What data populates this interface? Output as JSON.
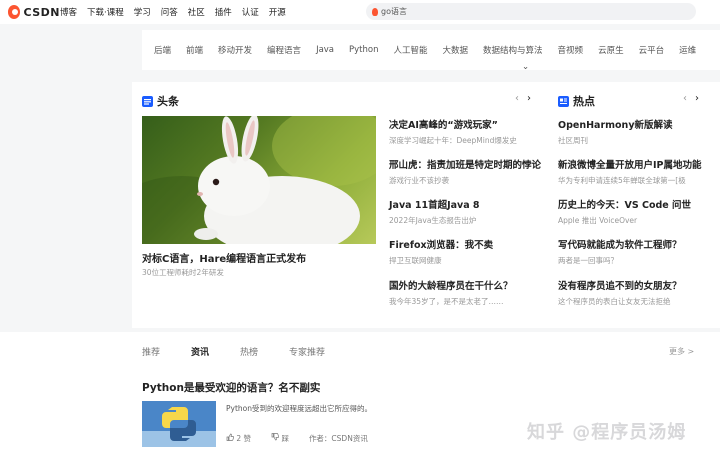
{
  "topbar": {
    "logo_text": "CSDN",
    "nav": [
      "博客",
      "下载·课程",
      "学习",
      "问答",
      "社区",
      "插件",
      "认证",
      "开源"
    ],
    "search_text": "go语言"
  },
  "categories": {
    "items": [
      "后端",
      "前端",
      "移动开发",
      "编程语言",
      "Java",
      "Python",
      "人工智能",
      "大数据",
      "数据结构与算法",
      "音视频",
      "云原生",
      "云平台",
      "运维"
    ],
    "expand_icon": "chevron-down-icon"
  },
  "headlines": {
    "title": "头条",
    "hero_caption": "对标C语言，Hare编程语言正式发布",
    "hero_sub": "30位工程师耗时2年研发",
    "items": [
      {
        "title": "决定AI高峰的“游戏玩家”",
        "sub": "深度学习崛起十年：DeepMind爆发史"
      },
      {
        "title": "邢山虎：指责加班是特定时期的悖论",
        "sub": "游戏行业不该抄袭"
      },
      {
        "title": "Java 11首超Java 8",
        "sub": "2022年Java生态报告出炉"
      },
      {
        "title": "Firefox浏览器：我不卖",
        "sub": "捍卫互联网健康"
      },
      {
        "title": "国外的大龄程序员在干什么？",
        "sub": "我今年35岁了，是不是太老了……"
      }
    ]
  },
  "hot": {
    "title": "热点",
    "items": [
      {
        "title": "OpenHarmony新版解读",
        "sub": "社区周刊"
      },
      {
        "title": "新浪微博全量开放用户IP属地功能",
        "sub": "华为专利申请连续5年蝉联全球第一[极"
      },
      {
        "title": "历史上的今天：VS Code 问世",
        "sub": "Apple 推出 VoiceOver"
      },
      {
        "title": "写代码就能成为软件工程师？",
        "sub": "两者是一回事吗？"
      },
      {
        "title": "没有程序员追不到的女朋友？",
        "sub": "这个程序员的表白让女友无法拒绝"
      }
    ]
  },
  "feed": {
    "tabs": [
      "推荐",
      "资讯",
      "热榜",
      "专家推荐"
    ],
    "active_tab": "资讯",
    "more": "更多 >",
    "article": {
      "title": "Python是最受欢迎的语言？名不副实",
      "desc": "Python受到的欢迎程度远超出它所应得的。",
      "likes": "2 赞",
      "comments": "踩",
      "author": "作者：CSDN资讯"
    }
  },
  "watermark": "知乎 @程序员汤姆",
  "colors": {
    "brand": "#fc5531",
    "headline_icon": "#1a5cff",
    "hot_icon": "#1a5cff"
  }
}
